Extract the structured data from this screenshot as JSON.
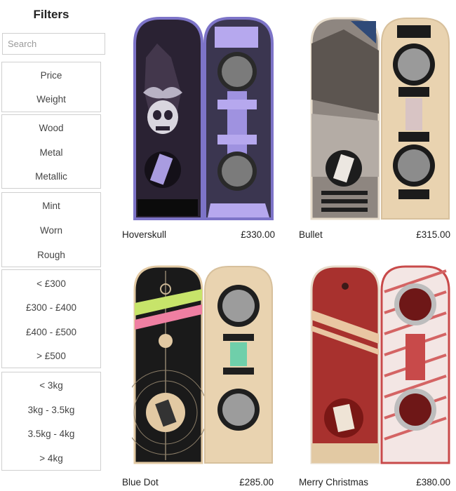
{
  "sidebar": {
    "title": "Filters",
    "search": {
      "placeholder": "Search",
      "value": ""
    },
    "groups": [
      {
        "items": [
          "Price",
          "Weight"
        ]
      },
      {
        "items": [
          "Wood",
          "Metal",
          "Metallic"
        ]
      },
      {
        "items": [
          "Mint",
          "Worn",
          "Rough"
        ]
      },
      {
        "items": [
          "< £300",
          "£300 - £400",
          "£400 - £500",
          "> £500"
        ]
      },
      {
        "items": [
          "< 3kg",
          "3kg - 3.5kg",
          "3.5kg - 4kg",
          "> 4kg"
        ]
      }
    ]
  },
  "products": [
    {
      "name": "Hoverskull",
      "price": "£330.00"
    },
    {
      "name": "Bullet",
      "price": "£315.00"
    },
    {
      "name": "Blue Dot",
      "price": "£285.00"
    },
    {
      "name": "Merry Christmas",
      "price": "£380.00"
    }
  ],
  "colors": {
    "border": "#cfcfcf",
    "wood": "#e9d3b0",
    "hoverskull_rim": "#7d74c8"
  }
}
